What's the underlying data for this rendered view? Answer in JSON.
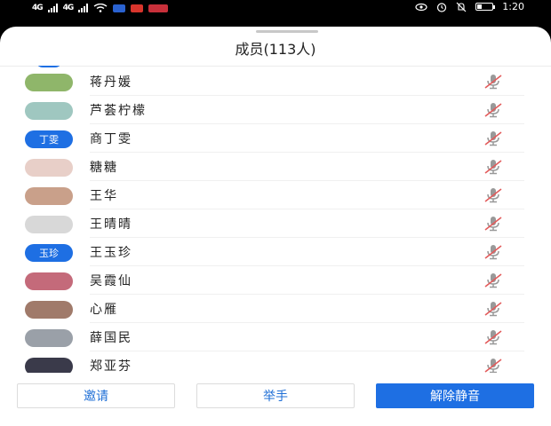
{
  "status_bar": {
    "sim1": "4G",
    "sim2": "4G",
    "time": "1:20"
  },
  "panel": {
    "title": "成员(113人)"
  },
  "members": [
    {
      "name": "蒋丹媛",
      "avatar_text": "",
      "avatar_color": "#8fb66a",
      "muted": true
    },
    {
      "name": "芦荟柠檬",
      "avatar_text": "",
      "avatar_color": "#9fc7c0",
      "muted": true
    },
    {
      "name": "商丁雯",
      "avatar_text": "丁雯",
      "avatar_color": "#1e6fe3",
      "muted": true
    },
    {
      "name": "糖糖",
      "avatar_text": "",
      "avatar_color": "#e8cfc8",
      "muted": true
    },
    {
      "name": "王华",
      "avatar_text": "",
      "avatar_color": "#c9a08a",
      "muted": true
    },
    {
      "name": "王晴晴",
      "avatar_text": "",
      "avatar_color": "#d8d8d8",
      "muted": true
    },
    {
      "name": "王玉珍",
      "avatar_text": "玉珍",
      "avatar_color": "#1e6fe3",
      "muted": true
    },
    {
      "name": "吴霞仙",
      "avatar_text": "",
      "avatar_color": "#c46a7a",
      "muted": true
    },
    {
      "name": "心雁",
      "avatar_text": "",
      "avatar_color": "#a07a6a",
      "muted": true
    },
    {
      "name": "薛国民",
      "avatar_text": "",
      "avatar_color": "#9aa0a8",
      "muted": true
    },
    {
      "name": "郑亚芬",
      "avatar_text": "",
      "avatar_color": "#3a3a4a",
      "muted": true
    }
  ],
  "actions": {
    "invite": "邀请",
    "raise_hand": "举手",
    "unmute": "解除静音"
  },
  "colors": {
    "accent": "#1e6fe3",
    "mute_red": "#e25b5b"
  }
}
